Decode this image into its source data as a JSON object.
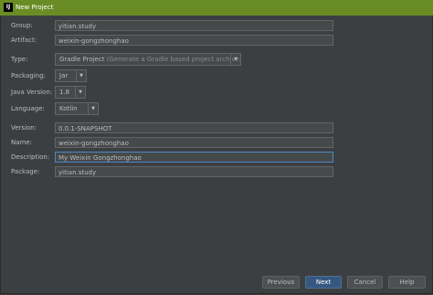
{
  "window": {
    "icon_text": "IJ",
    "title": "New Project"
  },
  "form": {
    "group": {
      "label": "Group:",
      "value": "yitian.study"
    },
    "artifact": {
      "label": "Artifact:",
      "value": "weixin-gongzhonghao"
    },
    "type": {
      "label": "Type:",
      "value": "Gradle Project",
      "hint": "(Generate a Gradle based project archive)"
    },
    "packaging": {
      "label": "Packaging:",
      "value": "Jar"
    },
    "java_version": {
      "label": "Java Version:",
      "value": "1.8"
    },
    "language": {
      "label": "Language:",
      "value": "Kotlin"
    },
    "version": {
      "label": "Version:",
      "value": "0.0.1-SNAPSHOT"
    },
    "name": {
      "label": "Name:",
      "value": "weixin-gongzhonghao"
    },
    "description": {
      "label": "Description:",
      "value": "My Weixin Gongzhonghao"
    },
    "package": {
      "label": "Package:",
      "value": "yitian.study"
    }
  },
  "buttons": {
    "previous": "Previous",
    "next": "Next",
    "cancel": "Cancel",
    "help": "Help"
  },
  "colors": {
    "titlebar": "#6a8c24",
    "background": "#3c3f41",
    "field": "#45494a",
    "default_button": "#365880",
    "focus_border": "#4a88c7"
  }
}
